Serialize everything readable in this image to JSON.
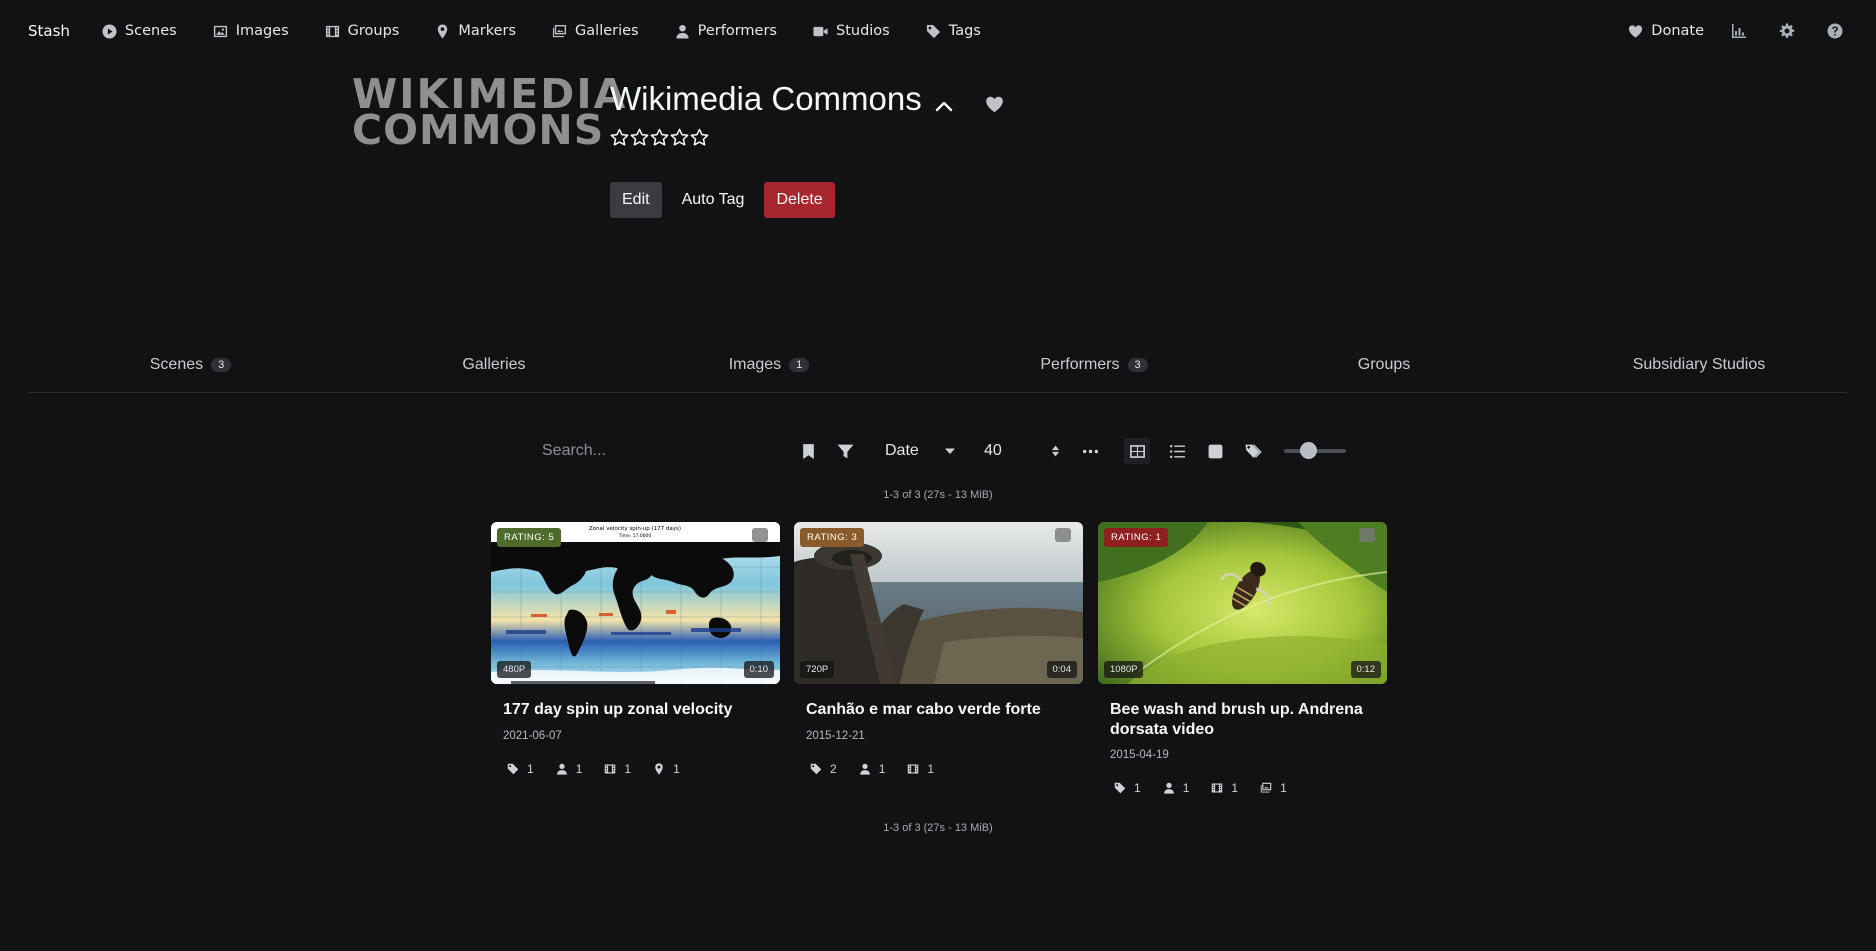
{
  "navbar": {
    "brand": "Stash",
    "items": [
      {
        "label": "Scenes",
        "icon": "play-circle-icon"
      },
      {
        "label": "Images",
        "icon": "image-icon"
      },
      {
        "label": "Groups",
        "icon": "film-icon"
      },
      {
        "label": "Markers",
        "icon": "map-marker-icon"
      },
      {
        "label": "Galleries",
        "icon": "images-icon"
      },
      {
        "label": "Performers",
        "icon": "user-icon"
      },
      {
        "label": "Studios",
        "icon": "video-icon"
      },
      {
        "label": "Tags",
        "icon": "tag-icon"
      }
    ],
    "donate_label": "Donate",
    "right_icons": [
      "stats-chart-icon",
      "gear-icon",
      "help-circle-icon"
    ]
  },
  "studio": {
    "logo_line1": "WIKIMEDIA",
    "logo_line2": "COMMONS",
    "name": "Wikimedia Commons",
    "rating": 0,
    "rating_max": 5
  },
  "actions": {
    "edit_label": "Edit",
    "auto_tag_label": "Auto Tag",
    "delete_label": "Delete"
  },
  "tabs": [
    {
      "label": "Scenes",
      "count": "3",
      "active": true
    },
    {
      "label": "Galleries",
      "count": "",
      "active": false
    },
    {
      "label": "Images",
      "count": "1",
      "active": false
    },
    {
      "label": "Performers",
      "count": "3",
      "active": false
    },
    {
      "label": "Groups",
      "count": "",
      "active": false
    },
    {
      "label": "Subsidiary Studios",
      "count": "",
      "active": false
    }
  ],
  "toolbar": {
    "search_placeholder": "Search...",
    "sort_by": "Date",
    "per_page": "40",
    "zoom_level": 0.35
  },
  "pagination": {
    "top": "1-3 of 3 (27s - 13 MiB)",
    "bottom": "1-3 of 3 (27s - 13 MiB)"
  },
  "scenes": [
    {
      "rating_label": "RATING: 5",
      "rating_color": "#4d6b2a",
      "resolution": "480P",
      "duration": "0:10",
      "title": "177 day spin up zonal velocity",
      "date": "2021-06-07",
      "thumb_caption_1": "Zonal velocity spin-up (177 days)",
      "thumb_caption_2": "Time: 17.0000",
      "resume_progress": 0.6,
      "pops": [
        {
          "icon": "tag-icon",
          "count": "1"
        },
        {
          "icon": "user-icon",
          "count": "1"
        },
        {
          "icon": "film-icon",
          "count": "1"
        },
        {
          "icon": "map-marker-icon",
          "count": "1"
        }
      ]
    },
    {
      "rating_label": "RATING: 3",
      "rating_color": "#8a5a2b",
      "resolution": "720P",
      "duration": "0:04",
      "title": "Canhão e mar cabo verde forte",
      "date": "2015-12-21",
      "pops": [
        {
          "icon": "tag-icon",
          "count": "2"
        },
        {
          "icon": "user-icon",
          "count": "1"
        },
        {
          "icon": "film-icon",
          "count": "1"
        }
      ]
    },
    {
      "rating_label": "RATING: 1",
      "rating_color": "#8f2020",
      "resolution": "1080P",
      "duration": "0:12",
      "title": "Bee wash and brush up. Andrena dorsata video",
      "date": "2015-04-19",
      "pops": [
        {
          "icon": "tag-icon",
          "count": "1"
        },
        {
          "icon": "user-icon",
          "count": "1"
        },
        {
          "icon": "film-icon",
          "count": "1"
        },
        {
          "icon": "images-icon",
          "count": "1"
        }
      ]
    }
  ]
}
